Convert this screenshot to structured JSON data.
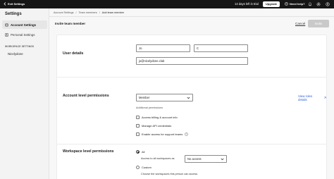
{
  "topbar": {
    "exit_label": "Exit Settings",
    "trial_text": "14 days left in trial",
    "upgrade_label": "Upgrade",
    "help_label": "Need help?",
    "icons": [
      "bell-icon",
      "gear-icon",
      "user-icon"
    ]
  },
  "sidebar": {
    "title": "Settings",
    "items": [
      {
        "label": "Account Settings",
        "icon": "account-icon",
        "active": true
      },
      {
        "label": "Personal Settings",
        "icon": "person-icon",
        "active": false
      }
    ],
    "section_label": "WORKSPACE SETTINGS",
    "workspace_name": "Nicelydone"
  },
  "breadcrumb": [
    "Account Settings",
    "Team members",
    "Add team member"
  ],
  "page": {
    "title": "Invite team member",
    "cancel_label": "Cancel",
    "submit_label": "Invite"
  },
  "user_details": {
    "label": "User details",
    "first_name": "Jo",
    "last_name": "C",
    "email": "jo@nicelydone.club"
  },
  "account_permissions": {
    "label": "Account level permissions",
    "role_value": "Member",
    "view_roles_label": "View roles details",
    "additional_label": "Additional permissions",
    "options": [
      {
        "label": "Access billing & account info",
        "checked": false
      },
      {
        "label": "Manage API credentials",
        "checked": false
      },
      {
        "label": "Enable access for support teams",
        "checked": false
      }
    ]
  },
  "workspace_permissions": {
    "label": "Workspace level permissions",
    "all_label": "All",
    "access_all_label": "Access to all workspaces as",
    "access_value": "No access",
    "custom_label": "Custom",
    "custom_desc": "Choose the workspaces this person can access",
    "selected": "All"
  },
  "colors": {
    "accent": "#2a5bd7",
    "topbar": "#161616",
    "disabled_button": "#c9c9c9"
  }
}
